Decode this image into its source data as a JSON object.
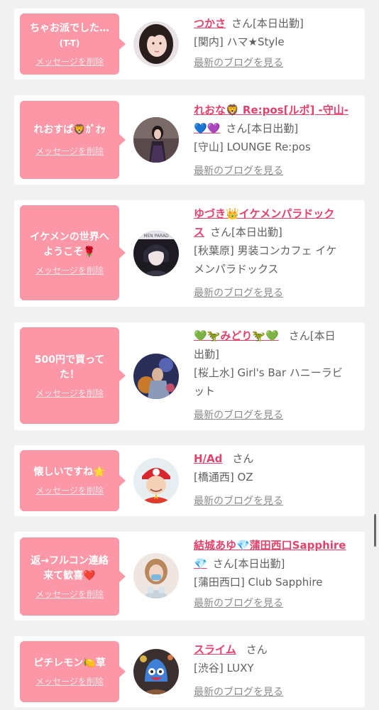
{
  "delete_label": "メッセージを削除",
  "san_label": "さん",
  "blog_label": "最新のブログを見る",
  "cards": [
    {
      "message_line1": "ちゃお派でした…",
      "message_line2": "(T-T)",
      "name": "つかさ",
      "status": "[本日出勤]",
      "area": "[関内]",
      "shop": "ハマ★Style"
    },
    {
      "message": "れおすぱ🦁ｶﾞｵｯ",
      "name_part1": "れおな🦁 Re:pos[ルポ] -守山-",
      "name_part2": "💙💜",
      "status": "[本日出勤]",
      "area": "[守山]",
      "shop": "LOUNGE Re:pos"
    },
    {
      "message_line1": "イケメンの世界へ",
      "message_line2": "ようこそ🌹",
      "name_line1": "ゆづき👑イケメンパラドック",
      "name_line2": "ス",
      "status": "[本日出勤]",
      "area": "[秋葉原]",
      "shop_line1": "男装コンカフェ イケ",
      "shop_line2": "メンパラドックス"
    },
    {
      "message_line1": "500円で買って",
      "message_line2": "た！",
      "name": "💚🦖みどり🦖💚",
      "status_line1": "[本日",
      "status_line2": "出勤]",
      "area": "[桜上水]",
      "shop_line1": "Girl's Bar ハニーラビ",
      "shop_line2": "ット"
    },
    {
      "message": "懐しいですね🌟",
      "name": "H/Ad",
      "area": "[橋通西]",
      "shop": "OZ"
    },
    {
      "message_line1": "返→フルコン連絡",
      "message_line2": "来て歓喜❤️",
      "name_line1": "結城あゆ💎蒲田西口Sapphire",
      "name_line2": "💎",
      "status": "[本日出勤]",
      "area": "[蒲田西口]",
      "shop": "Club Sapphire"
    },
    {
      "message": "ピチレモン🍋草",
      "name": "スライム",
      "area": "[渋谷]",
      "shop": "LUXY"
    }
  ],
  "colors": {
    "bubble": "#fb97a6",
    "name": "#e4416b",
    "page_bg": "#f1f1f1"
  }
}
